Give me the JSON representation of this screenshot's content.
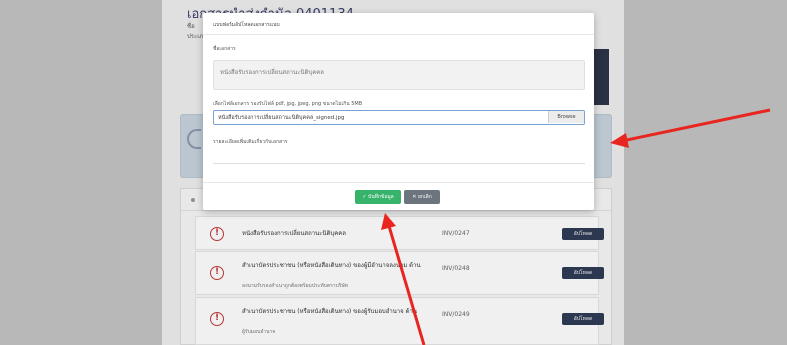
{
  "background": {
    "doc_title": "เอกสารนำส่งกำนัล 0401134",
    "doc_sub_lines": [
      "ชื่อ",
      "ประเภท"
    ],
    "list": {
      "rows": [
        {
          "title": "หนังสือรับรองการเปลี่ยนสถานะนิติบุคคล",
          "sub": "",
          "code": "INV/0247",
          "button": "อัปโหลด"
        },
        {
          "title": "สำเนาบัตรประชาชน (หรือหนังสือเดินทาง) ของผู้มีอำนาจลงนาม ด้าน",
          "sub": "ลงนามรับรองสำเนาถูกต้องพร้อมประทับตราบริษัท",
          "code": "INV/0248",
          "button": "อัปโหลด"
        },
        {
          "title": "สำเนาบัตรประชาชน (หรือหนังสือเดินทาง) ของผู้รับมอบอำนาจ ด้าน",
          "sub": "ผู้รับมอบอำนาจ",
          "code": "INV/0249",
          "button": "อัปโหลด"
        }
      ]
    }
  },
  "modal": {
    "title": "แบบฟอร์มอัปโหลดเอกสารแนบ",
    "field_name_label": "ชื่อเอกสาร",
    "field_name_value": "หนังสือรับรองการเปลี่ยนสถานะนิติบุคคล",
    "file_label": "เลือกไฟล์เอกสาร รองรับไฟล์ pdf, jpg, jpeg, png ขนาดไม่เกิน 5MB",
    "file_value": "หนังสือรับรองการเปลี่ยนสถานะนิติบุคคล_signed.jpg",
    "browse_label": "Browse",
    "remark_label": "รายละเอียดเพิ่มเติมเกี่ยวกับเอกสาร",
    "save_label": "✓ บันทึกข้อมูล",
    "cancel_label": "✕ ยกเลิก"
  },
  "colors": {
    "accent_save": "#37b36b",
    "cancel": "#6c757d",
    "annotation_arrow": "#e8251f"
  }
}
